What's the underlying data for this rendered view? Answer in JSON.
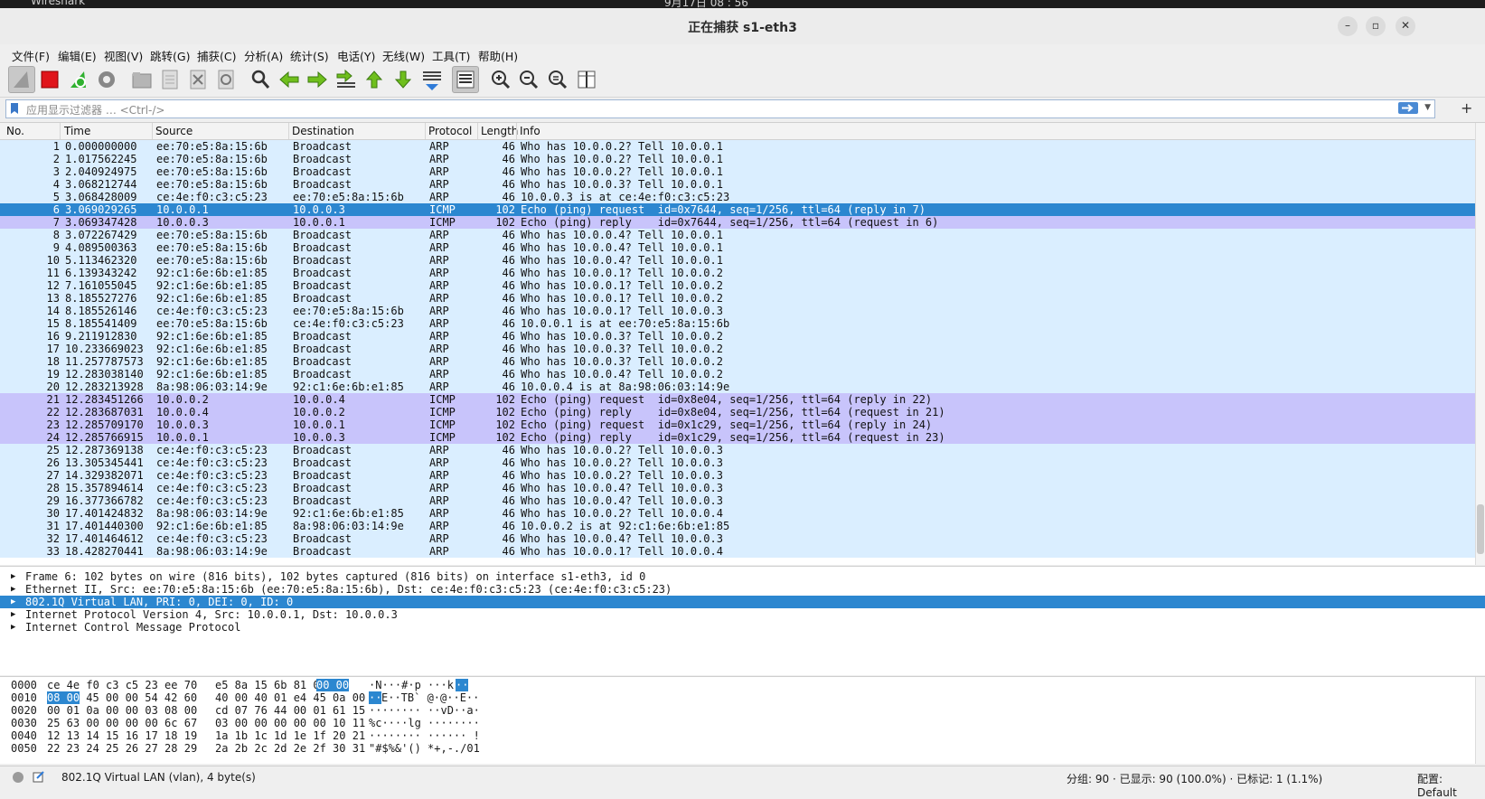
{
  "system": {
    "app": "Wireshark",
    "clock": "9月17日 08 : 56"
  },
  "window": {
    "title": "正在捕获 s1-eth3"
  },
  "menu": [
    "文件(F)",
    "编辑(E)",
    "视图(V)",
    "跳转(G)",
    "捕获(C)",
    "分析(A)",
    "统计(S)",
    "电话(Y)",
    "无线(W)",
    "工具(T)",
    "帮助(H)"
  ],
  "toolbar": [
    "shark-fin-start-icon",
    "stop-capture-icon",
    "restart-capture-icon",
    "capture-options-icon",
    "open-file-icon",
    "save-file-icon",
    "close-file-icon",
    "reload-file-icon",
    "find-packet-icon",
    "go-back-icon",
    "go-forward-icon",
    "go-to-packet-icon",
    "first-packet-icon",
    "last-packet-icon",
    "auto-scroll-icon",
    "colorize-icon",
    "zoom-in-icon",
    "zoom-out-icon",
    "normal-size-icon",
    "resize-columns-icon"
  ],
  "filter": {
    "placeholder": "应用显示过滤器 … <Ctrl-/>",
    "plus": "+"
  },
  "columns": [
    "No.",
    "Time",
    "Source",
    "Destination",
    "Protocol",
    "Length",
    "Info"
  ],
  "packets": [
    {
      "no": "1",
      "time": "0.000000000",
      "src": "ee:70:e5:8a:15:6b",
      "dst": "Broadcast",
      "proto": "ARP",
      "len": "46",
      "info": "Who has 10.0.0.2? Tell 10.0.0.1",
      "kind": "arp"
    },
    {
      "no": "2",
      "time": "1.017562245",
      "src": "ee:70:e5:8a:15:6b",
      "dst": "Broadcast",
      "proto": "ARP",
      "len": "46",
      "info": "Who has 10.0.0.2? Tell 10.0.0.1",
      "kind": "arp"
    },
    {
      "no": "3",
      "time": "2.040924975",
      "src": "ee:70:e5:8a:15:6b",
      "dst": "Broadcast",
      "proto": "ARP",
      "len": "46",
      "info": "Who has 10.0.0.2? Tell 10.0.0.1",
      "kind": "arp"
    },
    {
      "no": "4",
      "time": "3.068212744",
      "src": "ee:70:e5:8a:15:6b",
      "dst": "Broadcast",
      "proto": "ARP",
      "len": "46",
      "info": "Who has 10.0.0.3? Tell 10.0.0.1",
      "kind": "arp"
    },
    {
      "no": "5",
      "time": "3.068428009",
      "src": "ce:4e:f0:c3:c5:23",
      "dst": "ee:70:e5:8a:15:6b",
      "proto": "ARP",
      "len": "46",
      "info": "10.0.0.3 is at ce:4e:f0:c3:c5:23",
      "kind": "arp"
    },
    {
      "no": "6",
      "time": "3.069029265",
      "src": "10.0.0.1",
      "dst": "10.0.0.3",
      "proto": "ICMP",
      "len": "102",
      "info": "Echo (ping) request  id=0x7644, seq=1/256, ttl=64 (reply in 7)",
      "kind": "sel"
    },
    {
      "no": "7",
      "time": "3.069347428",
      "src": "10.0.0.3",
      "dst": "10.0.0.1",
      "proto": "ICMP",
      "len": "102",
      "info": "Echo (ping) reply    id=0x7644, seq=1/256, ttl=64 (request in 6)",
      "kind": "icmp"
    },
    {
      "no": "8",
      "time": "3.072267429",
      "src": "ee:70:e5:8a:15:6b",
      "dst": "Broadcast",
      "proto": "ARP",
      "len": "46",
      "info": "Who has 10.0.0.4? Tell 10.0.0.1",
      "kind": "arp"
    },
    {
      "no": "9",
      "time": "4.089500363",
      "src": "ee:70:e5:8a:15:6b",
      "dst": "Broadcast",
      "proto": "ARP",
      "len": "46",
      "info": "Who has 10.0.0.4? Tell 10.0.0.1",
      "kind": "arp"
    },
    {
      "no": "10",
      "time": "5.113462320",
      "src": "ee:70:e5:8a:15:6b",
      "dst": "Broadcast",
      "proto": "ARP",
      "len": "46",
      "info": "Who has 10.0.0.4? Tell 10.0.0.1",
      "kind": "arp"
    },
    {
      "no": "11",
      "time": "6.139343242",
      "src": "92:c1:6e:6b:e1:85",
      "dst": "Broadcast",
      "proto": "ARP",
      "len": "46",
      "info": "Who has 10.0.0.1? Tell 10.0.0.2",
      "kind": "arp"
    },
    {
      "no": "12",
      "time": "7.161055045",
      "src": "92:c1:6e:6b:e1:85",
      "dst": "Broadcast",
      "proto": "ARP",
      "len": "46",
      "info": "Who has 10.0.0.1? Tell 10.0.0.2",
      "kind": "arp"
    },
    {
      "no": "13",
      "time": "8.185527276",
      "src": "92:c1:6e:6b:e1:85",
      "dst": "Broadcast",
      "proto": "ARP",
      "len": "46",
      "info": "Who has 10.0.0.1? Tell 10.0.0.2",
      "kind": "arp"
    },
    {
      "no": "14",
      "time": "8.185526146",
      "src": "ce:4e:f0:c3:c5:23",
      "dst": "ee:70:e5:8a:15:6b",
      "proto": "ARP",
      "len": "46",
      "info": "Who has 10.0.0.1? Tell 10.0.0.3",
      "kind": "arp"
    },
    {
      "no": "15",
      "time": "8.185541409",
      "src": "ee:70:e5:8a:15:6b",
      "dst": "ce:4e:f0:c3:c5:23",
      "proto": "ARP",
      "len": "46",
      "info": "10.0.0.1 is at ee:70:e5:8a:15:6b",
      "kind": "arp"
    },
    {
      "no": "16",
      "time": "9.211912830",
      "src": "92:c1:6e:6b:e1:85",
      "dst": "Broadcast",
      "proto": "ARP",
      "len": "46",
      "info": "Who has 10.0.0.3? Tell 10.0.0.2",
      "kind": "arp"
    },
    {
      "no": "17",
      "time": "10.233669023",
      "src": "92:c1:6e:6b:e1:85",
      "dst": "Broadcast",
      "proto": "ARP",
      "len": "46",
      "info": "Who has 10.0.0.3? Tell 10.0.0.2",
      "kind": "arp"
    },
    {
      "no": "18",
      "time": "11.257787573",
      "src": "92:c1:6e:6b:e1:85",
      "dst": "Broadcast",
      "proto": "ARP",
      "len": "46",
      "info": "Who has 10.0.0.3? Tell 10.0.0.2",
      "kind": "arp"
    },
    {
      "no": "19",
      "time": "12.283038140",
      "src": "92:c1:6e:6b:e1:85",
      "dst": "Broadcast",
      "proto": "ARP",
      "len": "46",
      "info": "Who has 10.0.0.4? Tell 10.0.0.2",
      "kind": "arp"
    },
    {
      "no": "20",
      "time": "12.283213928",
      "src": "8a:98:06:03:14:9e",
      "dst": "92:c1:6e:6b:e1:85",
      "proto": "ARP",
      "len": "46",
      "info": "10.0.0.4 is at 8a:98:06:03:14:9e",
      "kind": "arp"
    },
    {
      "no": "21",
      "time": "12.283451266",
      "src": "10.0.0.2",
      "dst": "10.0.0.4",
      "proto": "ICMP",
      "len": "102",
      "info": "Echo (ping) request  id=0x8e04, seq=1/256, ttl=64 (reply in 22)",
      "kind": "icmp"
    },
    {
      "no": "22",
      "time": "12.283687031",
      "src": "10.0.0.4",
      "dst": "10.0.0.2",
      "proto": "ICMP",
      "len": "102",
      "info": "Echo (ping) reply    id=0x8e04, seq=1/256, ttl=64 (request in 21)",
      "kind": "icmp"
    },
    {
      "no": "23",
      "time": "12.285709170",
      "src": "10.0.0.3",
      "dst": "10.0.0.1",
      "proto": "ICMP",
      "len": "102",
      "info": "Echo (ping) request  id=0x1c29, seq=1/256, ttl=64 (reply in 24)",
      "kind": "icmp"
    },
    {
      "no": "24",
      "time": "12.285766915",
      "src": "10.0.0.1",
      "dst": "10.0.0.3",
      "proto": "ICMP",
      "len": "102",
      "info": "Echo (ping) reply    id=0x1c29, seq=1/256, ttl=64 (request in 23)",
      "kind": "icmp"
    },
    {
      "no": "25",
      "time": "12.287369138",
      "src": "ce:4e:f0:c3:c5:23",
      "dst": "Broadcast",
      "proto": "ARP",
      "len": "46",
      "info": "Who has 10.0.0.2? Tell 10.0.0.3",
      "kind": "arp"
    },
    {
      "no": "26",
      "time": "13.305345441",
      "src": "ce:4e:f0:c3:c5:23",
      "dst": "Broadcast",
      "proto": "ARP",
      "len": "46",
      "info": "Who has 10.0.0.2? Tell 10.0.0.3",
      "kind": "arp"
    },
    {
      "no": "27",
      "time": "14.329382071",
      "src": "ce:4e:f0:c3:c5:23",
      "dst": "Broadcast",
      "proto": "ARP",
      "len": "46",
      "info": "Who has 10.0.0.2? Tell 10.0.0.3",
      "kind": "arp"
    },
    {
      "no": "28",
      "time": "15.357894614",
      "src": "ce:4e:f0:c3:c5:23",
      "dst": "Broadcast",
      "proto": "ARP",
      "len": "46",
      "info": "Who has 10.0.0.4? Tell 10.0.0.3",
      "kind": "arp"
    },
    {
      "no": "29",
      "time": "16.377366782",
      "src": "ce:4e:f0:c3:c5:23",
      "dst": "Broadcast",
      "proto": "ARP",
      "len": "46",
      "info": "Who has 10.0.0.4? Tell 10.0.0.3",
      "kind": "arp"
    },
    {
      "no": "30",
      "time": "17.401424832",
      "src": "8a:98:06:03:14:9e",
      "dst": "92:c1:6e:6b:e1:85",
      "proto": "ARP",
      "len": "46",
      "info": "Who has 10.0.0.2? Tell 10.0.0.4",
      "kind": "arp"
    },
    {
      "no": "31",
      "time": "17.401440300",
      "src": "92:c1:6e:6b:e1:85",
      "dst": "8a:98:06:03:14:9e",
      "proto": "ARP",
      "len": "46",
      "info": "10.0.0.2 is at 92:c1:6e:6b:e1:85",
      "kind": "arp"
    },
    {
      "no": "32",
      "time": "17.401464612",
      "src": "ce:4e:f0:c3:c5:23",
      "dst": "Broadcast",
      "proto": "ARP",
      "len": "46",
      "info": "Who has 10.0.0.4? Tell 10.0.0.3",
      "kind": "arp"
    },
    {
      "no": "33",
      "time": "18.428270441",
      "src": "8a:98:06:03:14:9e",
      "dst": "Broadcast",
      "proto": "ARP",
      "len": "46",
      "info": "Who has 10.0.0.1? Tell 10.0.0.4",
      "kind": "arp"
    }
  ],
  "details": [
    {
      "text": "Frame 6: 102 bytes on wire (816 bits), 102 bytes captured (816 bits) on interface s1-eth3, id 0",
      "selected": false
    },
    {
      "text": "Ethernet II, Src: ee:70:e5:8a:15:6b (ee:70:e5:8a:15:6b), Dst: ce:4e:f0:c3:c5:23 (ce:4e:f0:c3:c5:23)",
      "selected": false
    },
    {
      "text": "802.1Q Virtual LAN, PRI: 0, DEI: 0, ID: 0",
      "selected": true
    },
    {
      "text": "Internet Protocol Version 4, Src: 10.0.0.1, Dst: 10.0.0.3",
      "selected": false
    },
    {
      "text": "Internet Control Message Protocol",
      "selected": false
    }
  ],
  "bytes": [
    {
      "off": "0000",
      "hex_a": "ce 4e f0 c3 c5 23 ee 70",
      "hex_b_pre": "e5 8a 15 6b 81 00 ",
      "hex_b_hl": "00 00",
      "hex_a_hl": "",
      "ascii_pre": "·N···#·p ···k",
      "ascii_hl": "··",
      "ascii_post": ""
    },
    {
      "off": "0010",
      "hex_a": " 45 00 00 54 42 60",
      "hex_a_hl": "08 00",
      "hex_b_pre": "40 00 40 01 e4 45 0a 00",
      "hex_b_hl": "",
      "ascii_pre": "",
      "ascii_hl": "··",
      "ascii_post": "E··TB` @·@··E··"
    },
    {
      "off": "0020",
      "hex_a": "00 01 0a 00 00 03 08 00",
      "hex_a_hl": "",
      "hex_b_pre": "cd 07 76 44 00 01 61 15",
      "hex_b_hl": "",
      "ascii_pre": "········ ··vD··a·",
      "ascii_hl": "",
      "ascii_post": ""
    },
    {
      "off": "0030",
      "hex_a": "25 63 00 00 00 00 6c 67",
      "hex_a_hl": "",
      "hex_b_pre": "03 00 00 00 00 00 10 11",
      "hex_b_hl": "",
      "ascii_pre": "%c····lg ········",
      "ascii_hl": "",
      "ascii_post": ""
    },
    {
      "off": "0040",
      "hex_a": "12 13 14 15 16 17 18 19",
      "hex_a_hl": "",
      "hex_b_pre": "1a 1b 1c 1d 1e 1f 20 21",
      "hex_b_hl": "",
      "ascii_pre": "········ ······ !",
      "ascii_hl": "",
      "ascii_post": ""
    },
    {
      "off": "0050",
      "hex_a": "22 23 24 25 26 27 28 29",
      "hex_a_hl": "",
      "hex_b_pre": "2a 2b 2c 2d 2e 2f 30 31",
      "hex_b_hl": "",
      "ascii_pre": "\"#$%&'() *+,-./01",
      "ascii_hl": "",
      "ascii_post": ""
    }
  ],
  "status": {
    "field": "802.1Q Virtual LAN (vlan), 4 byte(s)",
    "stats": "分组: 90 · 已显示: 90 (100.0%) · 已标记: 1 (1.1%)",
    "profile": "配置: Default"
  },
  "colors": {
    "arp_row": "#daeeff",
    "icmp_row": "#c8c4fb",
    "selected_row": "#2c87d0"
  }
}
